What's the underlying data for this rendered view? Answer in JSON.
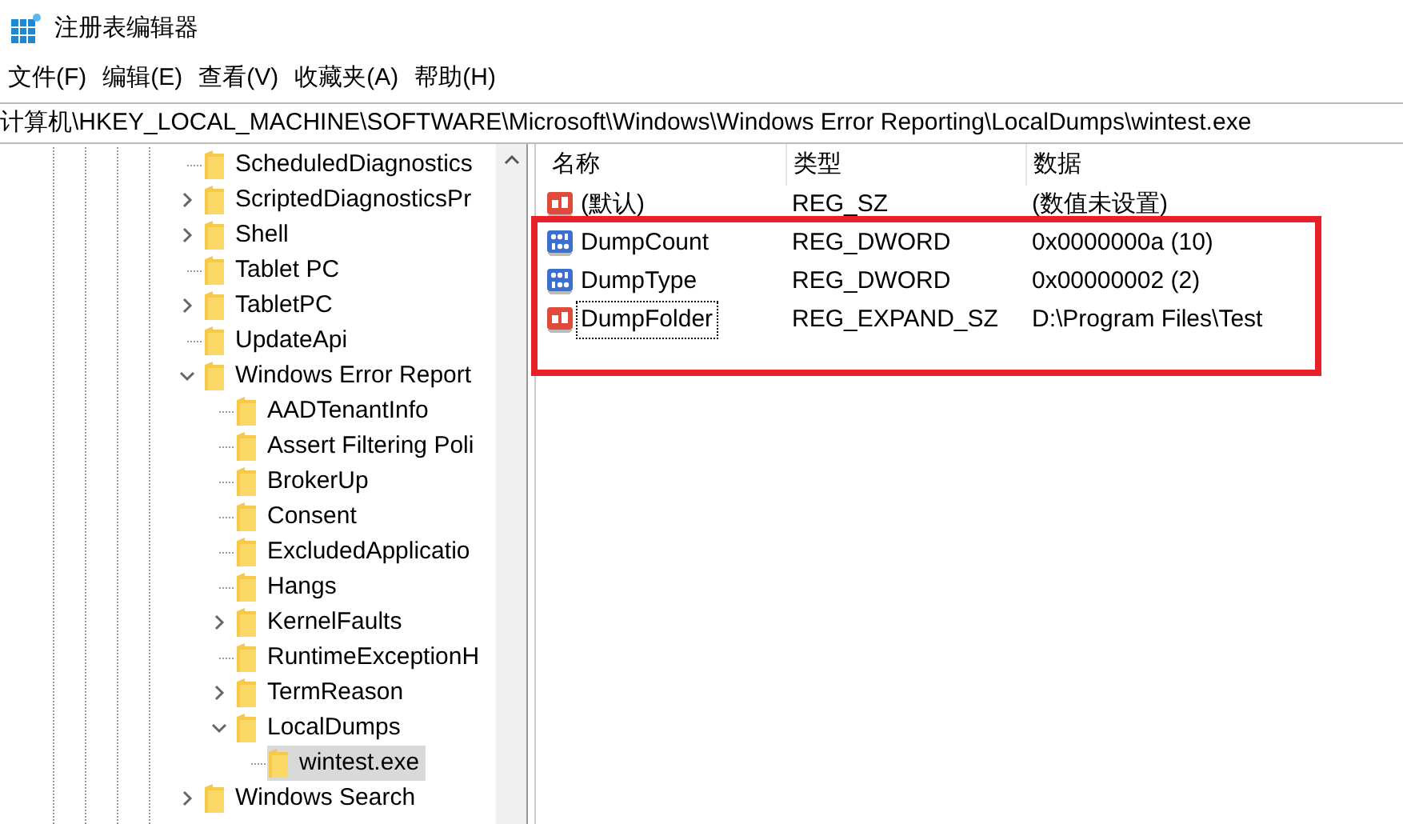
{
  "window": {
    "title": "注册表编辑器"
  },
  "menu": [
    "文件(F)",
    "编辑(E)",
    "查看(V)",
    "收藏夹(A)",
    "帮助(H)"
  ],
  "address": "计算机\\HKEY_LOCAL_MACHINE\\SOFTWARE\\Microsoft\\Windows\\Windows Error Reporting\\LocalDumps\\wintest.exe",
  "tree": [
    {
      "label": "ScheduledDiagnostics",
      "kind": "leaf",
      "selected": false
    },
    {
      "label": "ScriptedDiagnosticsPr",
      "kind": "branch",
      "expanded": false,
      "selected": false
    },
    {
      "label": "Shell",
      "kind": "branch",
      "expanded": false,
      "selected": false
    },
    {
      "label": "Tablet PC",
      "kind": "leaf",
      "selected": false
    },
    {
      "label": "TabletPC",
      "kind": "branch",
      "expanded": false,
      "selected": false
    },
    {
      "label": "UpdateApi",
      "kind": "leaf",
      "selected": false
    },
    {
      "label": "Windows Error Report",
      "kind": "branch",
      "expanded": true,
      "selected": false,
      "children": [
        {
          "label": "AADTenantInfo",
          "kind": "leaf",
          "selected": false
        },
        {
          "label": "Assert Filtering Poli",
          "kind": "leaf",
          "selected": false
        },
        {
          "label": "BrokerUp",
          "kind": "leaf",
          "selected": false
        },
        {
          "label": "Consent",
          "kind": "leaf",
          "selected": false
        },
        {
          "label": "ExcludedApplicatio",
          "kind": "leaf",
          "selected": false
        },
        {
          "label": "Hangs",
          "kind": "leaf",
          "selected": false
        },
        {
          "label": "KernelFaults",
          "kind": "branch",
          "expanded": false,
          "selected": false
        },
        {
          "label": "RuntimeExceptionH",
          "kind": "leaf",
          "selected": false
        },
        {
          "label": "TermReason",
          "kind": "branch",
          "expanded": false,
          "selected": false
        },
        {
          "label": "LocalDumps",
          "kind": "branch",
          "expanded": true,
          "selected": false,
          "children": [
            {
              "label": "wintest.exe",
              "kind": "leaf",
              "selected": true
            }
          ]
        }
      ]
    },
    {
      "label": "Windows Search",
      "kind": "branch",
      "expanded": false,
      "selected": false
    }
  ],
  "table": {
    "columns": [
      "名称",
      "类型",
      "数据"
    ],
    "rows": [
      {
        "name": "(默认)",
        "kind": "string",
        "type": "REG_SZ",
        "data": "(数值未设置)",
        "focused": false
      },
      {
        "name": "DumpCount",
        "kind": "binary",
        "type": "REG_DWORD",
        "data": "0x0000000a (10)",
        "focused": false
      },
      {
        "name": "DumpType",
        "kind": "binary",
        "type": "REG_DWORD",
        "data": "0x00000002 (2)",
        "focused": false
      },
      {
        "name": "DumpFolder",
        "kind": "string",
        "type": "REG_EXPAND_SZ",
        "data": "D:\\Program Files\\Test",
        "focused": true
      }
    ]
  }
}
